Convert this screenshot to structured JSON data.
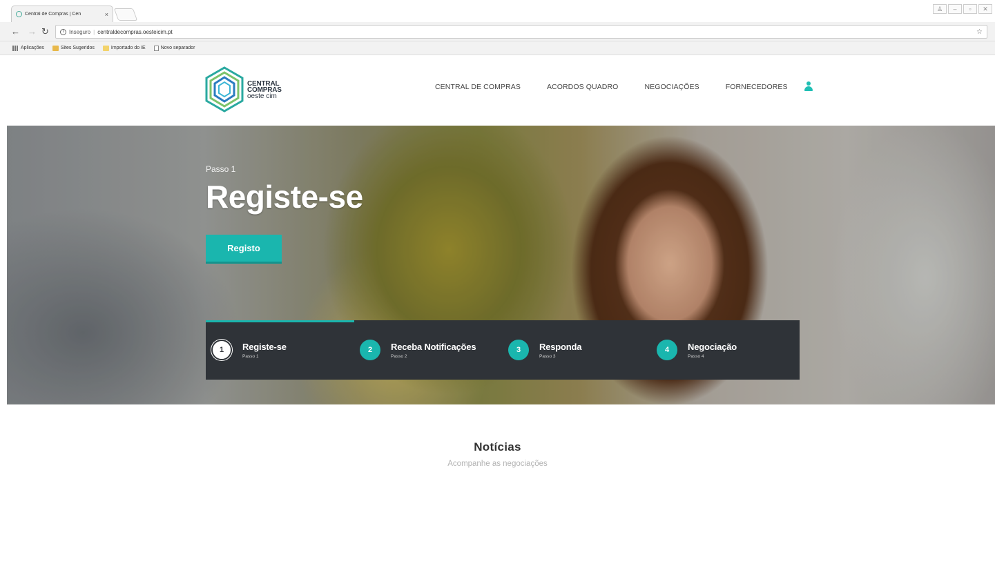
{
  "browser": {
    "tab_title": "Central de Compras | Cen",
    "tab_close": "×",
    "url_security": "Inseguro",
    "url_separator": "|",
    "url": "centraldecompras.oesteicim.pt",
    "bookmarks": [
      "Aplicações",
      "Sites Sugeridos",
      "Importado do IE",
      "Novo separador"
    ]
  },
  "site": {
    "logo": {
      "line1": "CENTRAL",
      "line2": "COMPRAS",
      "line3": "oeste cim"
    },
    "nav": [
      "CENTRAL DE COMPRAS",
      "ACORDOS QUADRO",
      "NEGOCIAÇÕES",
      "FORNECEDORES"
    ],
    "accent_color": "#1ab6ae"
  },
  "hero": {
    "kicker": "Passo 1",
    "title": "Registe-se",
    "button": "Registo",
    "steps": [
      {
        "num": "1",
        "name": "Registe-se",
        "sub": "Passo 1"
      },
      {
        "num": "2",
        "name": "Receba Notificações",
        "sub": "Passo 2"
      },
      {
        "num": "3",
        "name": "Responda",
        "sub": "Passo 3"
      },
      {
        "num": "4",
        "name": "Negociação",
        "sub": "Passo 4"
      }
    ]
  },
  "news": {
    "title": "Notícias",
    "subtitle": "Acompanhe as negociações"
  }
}
